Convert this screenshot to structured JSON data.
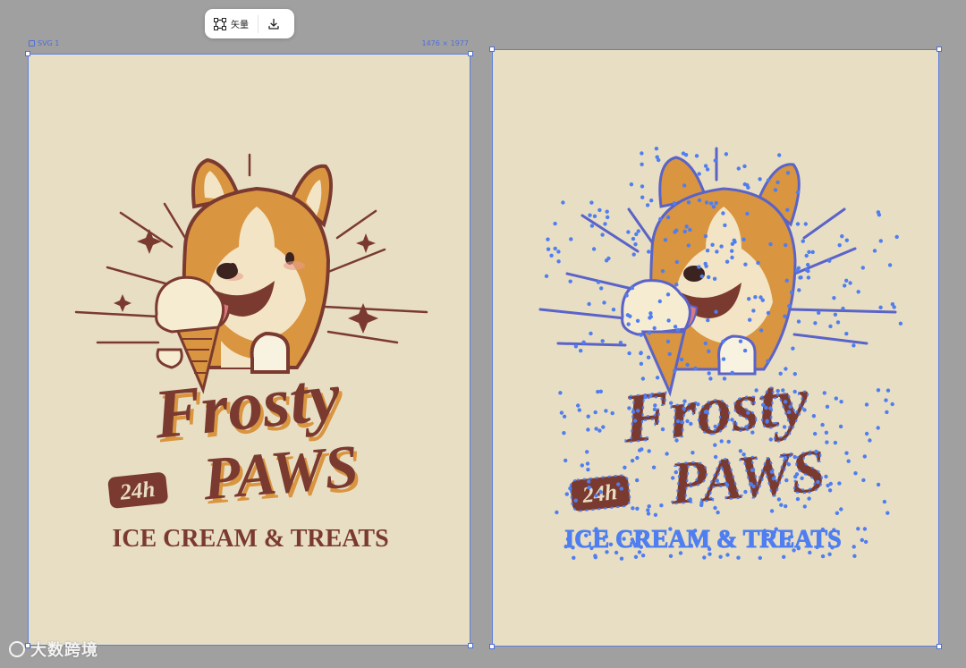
{
  "toolbar": {
    "vector_label": "矢量",
    "vector_icon": "vector-path-icon",
    "download_icon": "download-icon"
  },
  "frame": {
    "name": "SVG 1",
    "size": "1476 × 1977"
  },
  "logo": {
    "title_line1": "Frosty",
    "badge": "24h",
    "title_line2": "PAWS",
    "tagline": "ICE CREAM & TREATS"
  },
  "watermark": {
    "text": "大数跨境"
  },
  "colors": {
    "canvas": "#a0a0a0",
    "artboard": "#e8dec3",
    "brown": "#7b3a30",
    "orange": "#d9953f",
    "selection": "#5b7fe0",
    "vertex": "#4f7ef0"
  }
}
